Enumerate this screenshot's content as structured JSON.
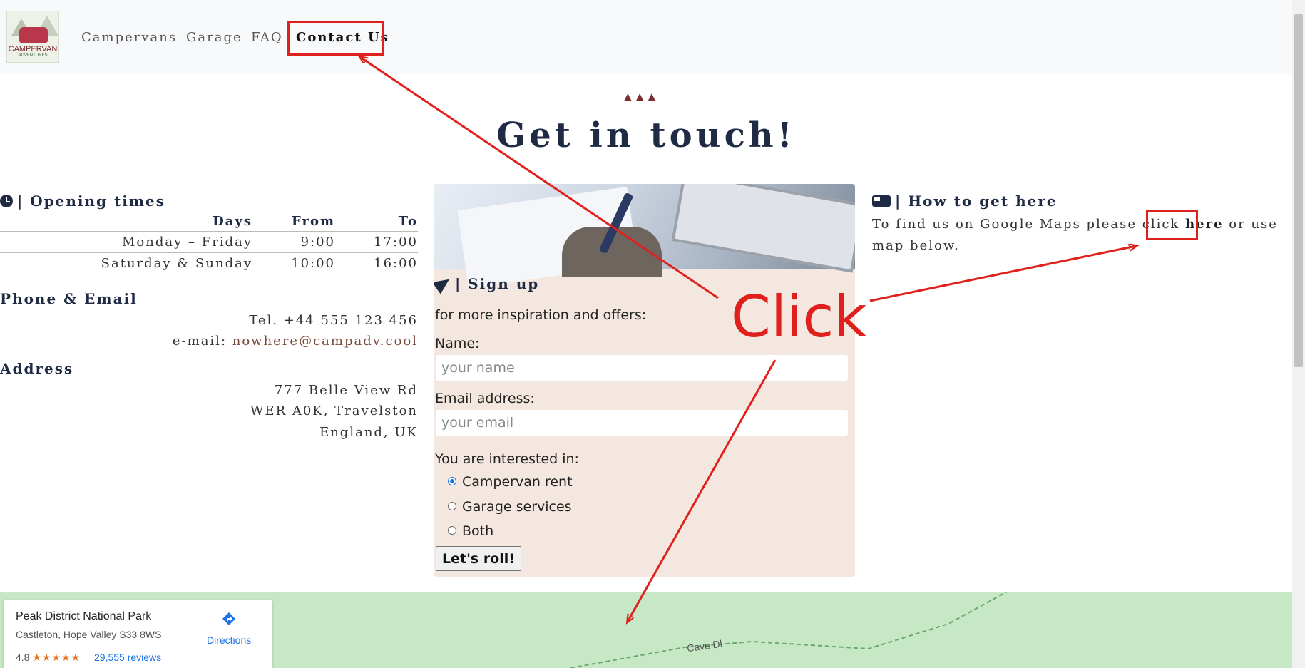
{
  "nav": {
    "logo_line1": "CAMPERVAN",
    "logo_line2": "ADVENTURES",
    "links": [
      "Campervans",
      "Garage",
      "FAQ",
      "Contact Us"
    ],
    "active": "Contact Us"
  },
  "hero": {
    "ornament": "▲▲▲",
    "title": "Get in touch!"
  },
  "opening": {
    "heading": "| Opening times",
    "columns": [
      "Days",
      "From",
      "To"
    ],
    "rows": [
      [
        "Monday – Friday",
        "9:00",
        "17:00"
      ],
      [
        "Saturday & Sunday",
        "10:00",
        "16:00"
      ]
    ]
  },
  "contact": {
    "heading": "Phone & Email",
    "phone": "Tel. +44 555 123 456",
    "email_label": "e-mail: ",
    "email": "nowhere@campadv.cool"
  },
  "address": {
    "heading": "Address",
    "line1": "777 Belle View Rd",
    "line2": "WER A0K, Travelston",
    "line3": "England, UK"
  },
  "signup": {
    "heading": "| Sign up",
    "subtitle": "for more inspiration and offers:",
    "name_label": "Name:",
    "name_placeholder": "your name",
    "email_label": "Email address:",
    "email_placeholder": "your email",
    "interest_label": "You are interested in:",
    "options": [
      "Campervan rent",
      "Garage services",
      "Both"
    ],
    "selected_option": "Campervan rent",
    "submit": "Let's roll!"
  },
  "directions": {
    "heading": "| How to get here",
    "text_before": "To find us on Google Maps please click ",
    "link": "here",
    "text_after": " or use map below."
  },
  "map": {
    "place": "Peak District National Park",
    "address": "Castleton, Hope Valley S33 8WS",
    "rating": "4.8",
    "stars": "★★★★★",
    "reviews": "29,555 reviews",
    "directions": "Directions",
    "road_label": "Cave Dl"
  },
  "annotation": {
    "text": "Click",
    "color": "#e0201c"
  }
}
